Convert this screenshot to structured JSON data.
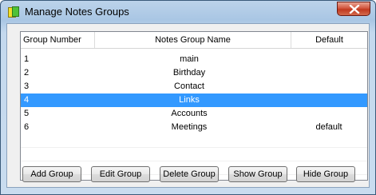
{
  "window": {
    "title": "Manage Notes Groups"
  },
  "table": {
    "columns": [
      "Group Number",
      "Notes Group Name",
      "Default"
    ],
    "rows": [
      {
        "number": "1",
        "name": "main",
        "default": ""
      },
      {
        "number": "2",
        "name": "Birthday",
        "default": ""
      },
      {
        "number": "3",
        "name": "Contact",
        "default": ""
      },
      {
        "number": "4",
        "name": "Links",
        "default": "",
        "selected": true
      },
      {
        "number": "5",
        "name": "Accounts",
        "default": ""
      },
      {
        "number": "6",
        "name": "Meetings",
        "default": "default"
      }
    ]
  },
  "buttons": {
    "add": "Add Group",
    "edit": "Edit Group",
    "delete": "Delete Group",
    "show": "Show Group",
    "hide": "Hide Group"
  },
  "colors": {
    "selection": "#3399ff",
    "close": "#c7432a"
  },
  "icons": {
    "app": "notes-app-icon",
    "close": "close-icon"
  }
}
